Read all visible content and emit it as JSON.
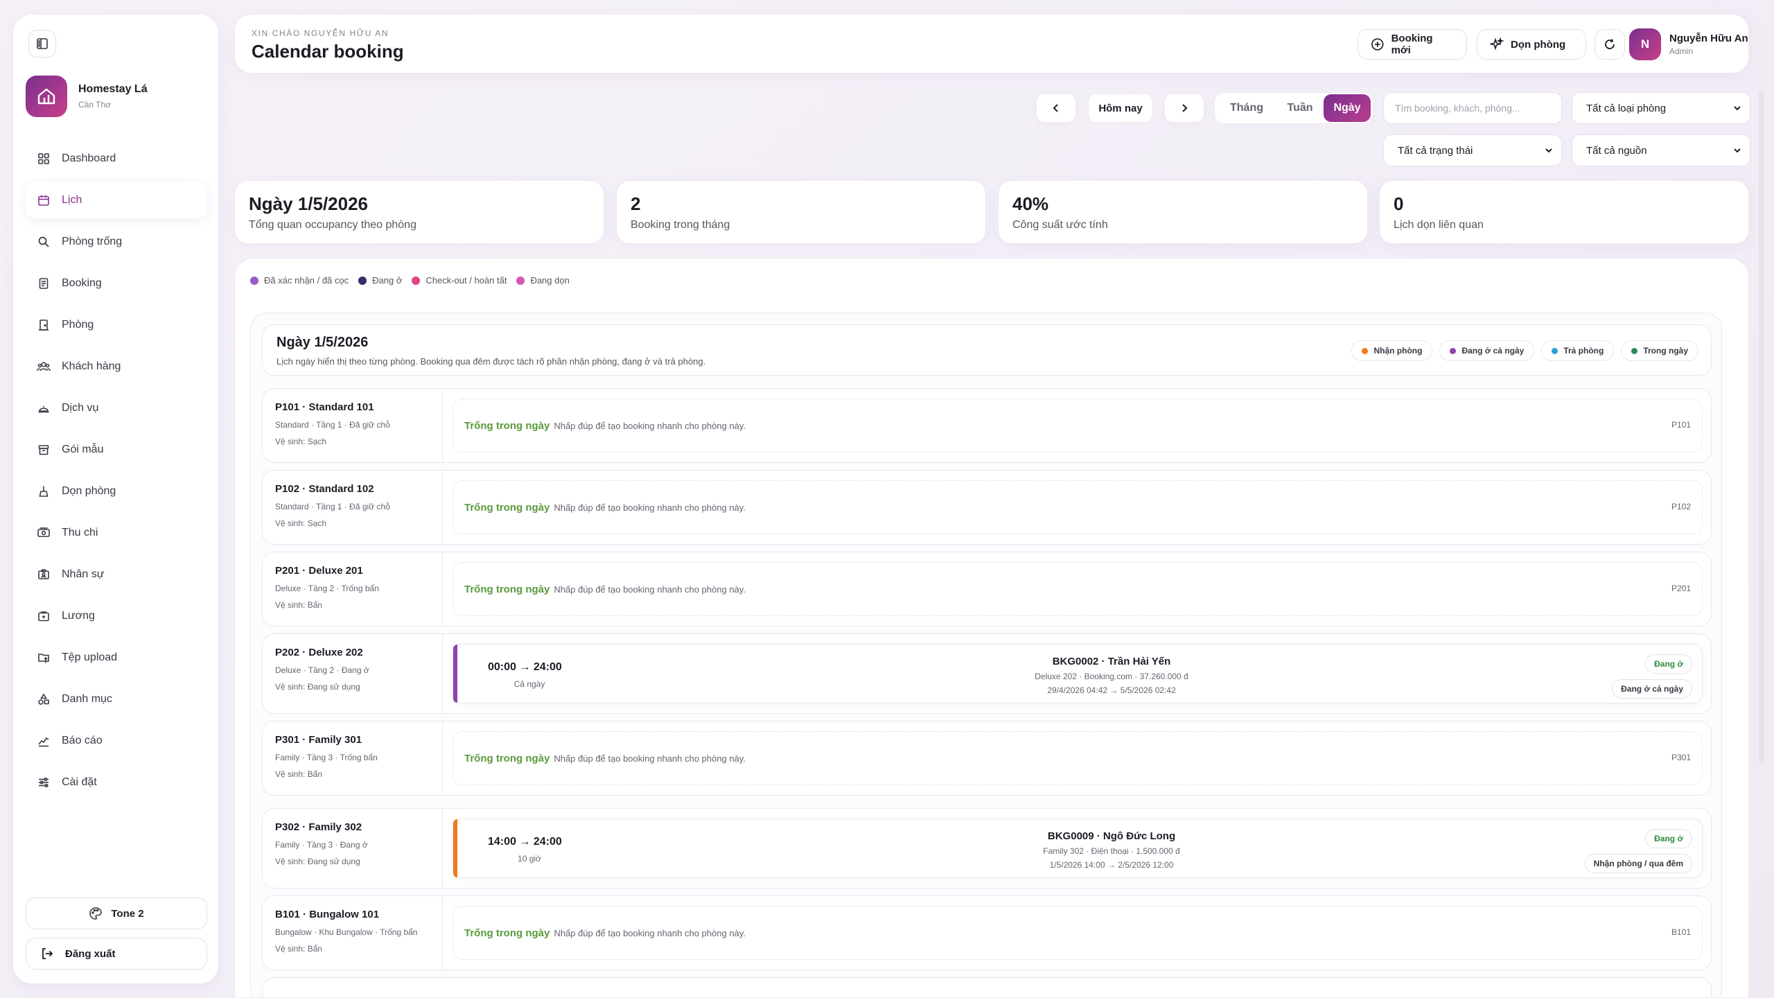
{
  "sidebar": {
    "brand_name": "Homestay Lá",
    "brand_location": "Cần Thơ",
    "items": [
      {
        "label": "Dashboard",
        "icon": "grid-icon"
      },
      {
        "label": "Lịch",
        "icon": "calendar-icon",
        "active": true
      },
      {
        "label": "Phòng trống",
        "icon": "search-icon"
      },
      {
        "label": "Booking",
        "icon": "receipt-icon"
      },
      {
        "label": "Phòng",
        "icon": "door-icon"
      },
      {
        "label": "Khách hàng",
        "icon": "users-icon"
      },
      {
        "label": "Dịch vụ",
        "icon": "service-bell-icon"
      },
      {
        "label": "Gói mẫu",
        "icon": "box-icon"
      },
      {
        "label": "Dọn phòng",
        "icon": "broom-icon"
      },
      {
        "label": "Thu chi",
        "icon": "cash-icon"
      },
      {
        "label": "Nhân sự",
        "icon": "id-card-icon"
      },
      {
        "label": "Lương",
        "icon": "wallet-icon"
      },
      {
        "label": "Tệp upload",
        "icon": "upload-icon"
      },
      {
        "label": "Danh mục",
        "icon": "category-icon"
      },
      {
        "label": "Báo cáo",
        "icon": "chart-icon"
      },
      {
        "label": "Cài đặt",
        "icon": "sliders-icon"
      }
    ],
    "tone_label": "Tone 2",
    "logout_label": "Đăng xuất"
  },
  "header": {
    "greeting": "XIN CHÀO NGUYỄN HỮU AN",
    "title": "Calendar booking",
    "new_booking": "Booking mới",
    "cleaning": "Dọn phòng",
    "user_initial": "N",
    "user_name": "Nguyễn Hữu An",
    "user_role": "Admin"
  },
  "toolbar": {
    "today": "Hôm nay",
    "views": [
      "Tháng",
      "Tuần",
      "Ngày"
    ],
    "active_view": "Ngày",
    "search_placeholder": "Tìm booking, khách, phòng...",
    "filter_room_type": "Tất cả loại phòng",
    "filter_status": "Tất cả trạng thái",
    "filter_source": "Tất cả nguồn"
  },
  "stats": [
    {
      "value": "Ngày 1/5/2026",
      "label": "Tổng quan occupancy theo phòng"
    },
    {
      "value": "2",
      "label": "Booking trong tháng"
    },
    {
      "value": "40%",
      "label": "Công suất ước tính"
    },
    {
      "value": "0",
      "label": "Lịch dọn liên quan"
    }
  ],
  "legend": [
    {
      "label": "Đã xác nhận / đã cọc",
      "color": "#9b59c6"
    },
    {
      "label": "Đang ở",
      "color": "#3b2a6b"
    },
    {
      "label": "Check-out / hoàn tất",
      "color": "#e0448a"
    },
    {
      "label": "Đang dọn",
      "color": "#d15ab0"
    }
  ],
  "day": {
    "title": "Ngày 1/5/2026",
    "description": "Lịch ngày hiển thị theo từng phòng. Booking qua đêm được tách rõ phần nhận phòng, đang ở và trả phòng.",
    "chips": [
      {
        "label": "Nhận phòng",
        "color": "#f07a1a"
      },
      {
        "label": "Đang ở cả ngày",
        "color": "#8e44ad"
      },
      {
        "label": "Trả phòng",
        "color": "#29a3d6"
      },
      {
        "label": "Trong ngày",
        "color": "#2e8b5a"
      }
    ],
    "free_label": "Trống trong ngày",
    "free_hint": "Nhấp đúp để tạo booking nhanh cho phòng này.",
    "rooms": [
      {
        "name": "P101 · Standard 101",
        "meta": "Standard · Tầng 1 · Đã giữ chỗ",
        "clean": "Vệ sinh: Sạch",
        "code": "P101"
      },
      {
        "name": "P102 · Standard 102",
        "meta": "Standard · Tầng 1 · Đã giữ chỗ",
        "clean": "Vệ sinh: Sạch",
        "code": "P102"
      },
      {
        "name": "P201 · Deluxe 201",
        "meta": "Deluxe · Tầng 2 · Trống bẩn",
        "clean": "Vệ sinh: Bẩn",
        "code": "P201"
      },
      {
        "name": "P202 · Deluxe 202",
        "meta": "Deluxe · Tầng 2 · Đang ở",
        "clean": "Vệ sinh: Đang sử dụng",
        "booking": {
          "time": "00:00 → 24:00",
          "time_sub": "Cả ngày",
          "title": "BKG0002 · Trần Hải Yến",
          "line1": "Deluxe 202 · Booking.com · 37.260.000 đ",
          "line2": "29/4/2026 04:42 → 5/5/2026 02:42",
          "status": "Đang ở",
          "phase": "Đang ở cả ngày",
          "accent": "#8e44ad"
        }
      },
      {
        "name": "P301 · Family 301",
        "meta": "Family · Tầng 3 · Trống bẩn",
        "clean": "Vệ sinh: Bẩn",
        "code": "P301"
      },
      {
        "name": "P302 · Family 302",
        "meta": "Family · Tầng 3 · Đang ở",
        "clean": "Vệ sinh: Đang sử dụng",
        "booking": {
          "time": "14:00 → 24:00",
          "time_sub": "10 giờ",
          "title": "BKG0009 · Ngô Đức Long",
          "line1": "Family 302 · Điện thoại · 1.500.000 đ",
          "line2": "1/5/2026 14:00 → 2/5/2026 12:00",
          "status": "Đang ở",
          "phase": "Nhận phòng / qua đêm",
          "accent": "#f07a1a"
        }
      },
      {
        "name": "B101 · Bungalow 101",
        "meta": "Bungalow · Khu Bungalow · Trống bẩn",
        "clean": "Vệ sinh: Bẩn",
        "code": "B101"
      }
    ]
  }
}
